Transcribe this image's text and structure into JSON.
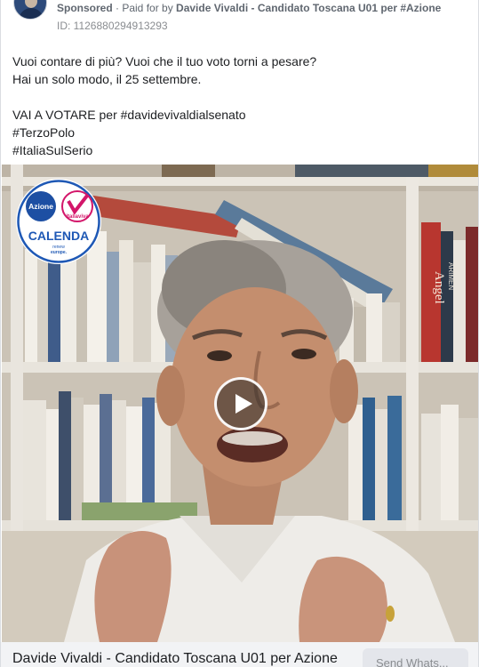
{
  "ad": {
    "sponsored_label": "Sponsored",
    "paid_for_prefix": " · Paid for by ",
    "advertiser": "Davide Vivaldi - Candidato Toscana U01 per #Azione",
    "id_line": "ID: 1126880294913293"
  },
  "post": {
    "lines": [
      "Vuoi contare di più? Vuoi che il tuo voto torni a pesare?",
      "Hai un solo modo, il 25 settembre.",
      "VAI A VOTARE per #davidevivaldialsenato",
      "#TerzoPolo",
      "#ItaliaSulSerio"
    ]
  },
  "logo": {
    "party_left": "Azione",
    "party_right": "italiaviva",
    "main": "CALENDA",
    "slogan_line1": "renew",
    "slogan_line2": "europe."
  },
  "book_spines": {
    "right_spine": "Angel",
    "spine_small": "ARIMEN"
  },
  "footer": {
    "title": "Davide Vivaldi - Candidato Toscana U01 per Azione",
    "cta_label": "Send Whats..."
  },
  "colors": {
    "azione_blue": "#1d4fa3",
    "italiaviva_pink": "#d3166a",
    "calenda_blue": "#1e58b5",
    "footer_bg": "#f2f3f5"
  },
  "icons": [
    "more-options-icon",
    "play-icon",
    "avatar"
  ]
}
